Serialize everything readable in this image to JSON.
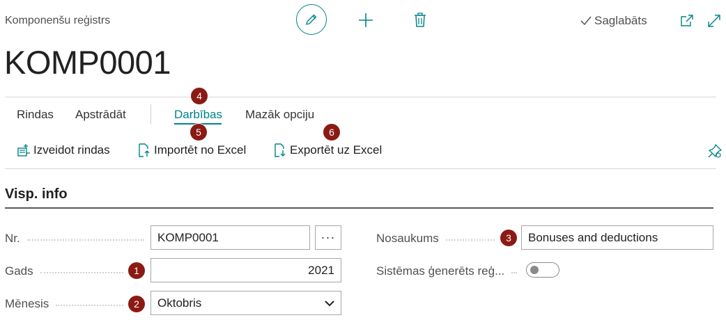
{
  "header": {
    "breadcrumb": "Komponenšu reģistrs",
    "status": "Saglabāts",
    "title": "KOMP0001"
  },
  "tabs": [
    {
      "label": "Rindas"
    },
    {
      "label": "Apstrādāt"
    },
    {
      "label": "Darbības",
      "active": true
    },
    {
      "label": "Mazāk opciju"
    }
  ],
  "actions": [
    {
      "label": "Izveidot rindas"
    },
    {
      "label": "Importēt no Excel"
    },
    {
      "label": "Exportēt uz Excel"
    }
  ],
  "badges": [
    "1",
    "2",
    "3",
    "4",
    "5",
    "6"
  ],
  "section": {
    "title": "Visp. info"
  },
  "fields": {
    "nr": {
      "label": "Nr.",
      "value": "KOMP0001"
    },
    "gads": {
      "label": "Gads",
      "value": "2021"
    },
    "menesis": {
      "label": "Mēnesis",
      "value": "Oktobris"
    },
    "nosaukums": {
      "label": "Nosaukums",
      "value": "Bonuses and deductions"
    },
    "sistemas": {
      "label": "Sistēmas ģenerēts reģ...",
      "value": false
    }
  },
  "colors": {
    "accent": "#00838a",
    "badge": "#8b1a14"
  }
}
